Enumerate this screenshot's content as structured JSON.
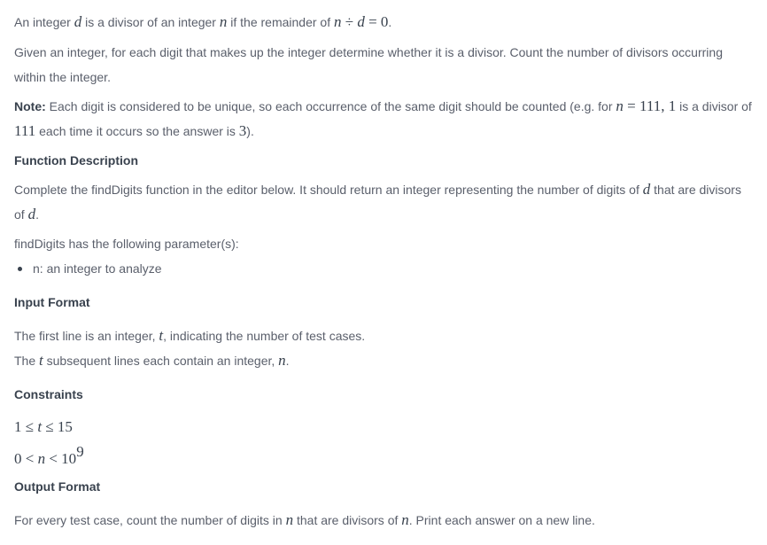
{
  "intro": {
    "t1": "An integer ",
    "d1": "d",
    "t2": " is a divisor of an integer ",
    "n1": "n",
    "t3": " if the remainder of ",
    "expr_n": "n",
    "expr_div": " ÷ ",
    "expr_d": "d",
    "expr_eq": " = 0",
    "end": "."
  },
  "given": "Given an integer, for each digit that makes up the integer determine whether it is a divisor. Count the number of divisors occurring within the integer.",
  "note": {
    "label": "Note:",
    "t1": " Each digit is considered to be unique, so each occurrence of the same digit should be counted (e.g. for ",
    "n": "n",
    "eq": " = 111",
    "c": ", 1",
    "t2": " is a divisor of ",
    "num": "111",
    "t3": " each time it occurs so the answer is ",
    "ans": "3",
    "t4": ")."
  },
  "function_description": {
    "heading": "Function Description",
    "t1": "Complete the findDigits function in the editor below. It should return an integer representing the number of digits of ",
    "d1": "d",
    "t2": " that are divisors of ",
    "d2": "d",
    "t3": "."
  },
  "parameters": {
    "intro": "findDigits has the following parameter(s):",
    "item": "n: an integer to analyze"
  },
  "input_format": {
    "heading": "Input Format",
    "l1a": "The first line is an integer, ",
    "l1t": "t",
    "l1b": ", indicating the number of test cases.",
    "l2a": "The ",
    "l2t": "t",
    "l2b": " subsequent lines each contain an integer, ",
    "l2n": "n",
    "l2c": "."
  },
  "constraints": {
    "heading": "Constraints",
    "c1_pre": "1 ≤ ",
    "c1_var": "t",
    "c1_post": " ≤ 15",
    "c2_pre": "0 < ",
    "c2_var": "n",
    "c2_post": " < 10",
    "c2_exp": "9"
  },
  "output_format": {
    "heading": "Output Format",
    "t1": "For every test case, count the number of digits in ",
    "n1": "n",
    "t2": " that are divisors of ",
    "n2": "n",
    "t3": ". Print each answer on a new line."
  }
}
